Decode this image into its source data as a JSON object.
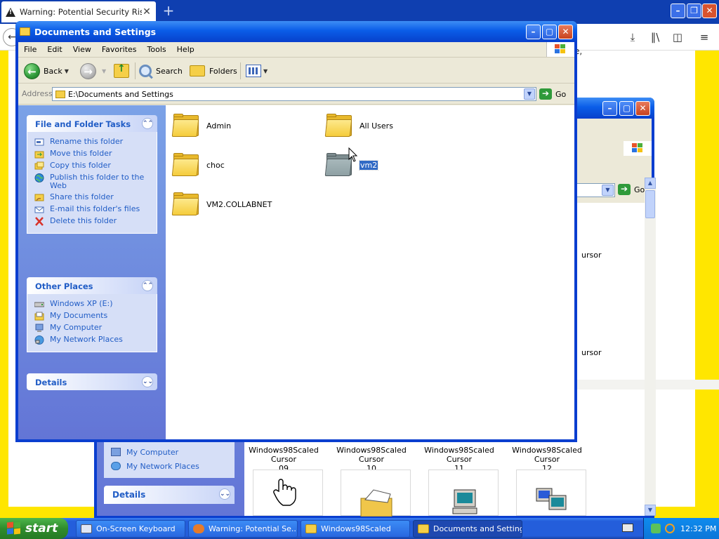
{
  "firefox": {
    "tab_title": "Warning: Potential Security Risk A",
    "side_text": "e,"
  },
  "bg_window": {
    "other_places": [
      "My Computer",
      "My Network Places"
    ],
    "details_label": "Details",
    "go_label": "Go",
    "cursor_labels": [
      {
        "line1": "Windows98Scaled Cursor",
        "line2": "09"
      },
      {
        "line1": "Windows98Scaled Cursor",
        "line2": "10"
      },
      {
        "line1": "Windows98Scaled Cursor",
        "line2": "11"
      },
      {
        "line1": "Windows98Scaled Cursor",
        "line2": "12"
      }
    ],
    "partial_label_1": "ursor",
    "partial_label_2": "ursor"
  },
  "window": {
    "title": "Documents and Settings",
    "menu": [
      "File",
      "Edit",
      "View",
      "Favorites",
      "Tools",
      "Help"
    ],
    "toolbar": {
      "back": "Back",
      "search": "Search",
      "folders": "Folders"
    },
    "address_label": "Address",
    "address_value": "E:\\Documents and Settings",
    "go_label": "Go",
    "panels": {
      "file_tasks": {
        "title": "File and Folder Tasks",
        "items": [
          "Rename this folder",
          "Move this folder",
          "Copy this folder",
          "Publish this folder to the Web",
          "Share this folder",
          "E-mail this folder's files",
          "Delete this folder"
        ]
      },
      "other_places": {
        "title": "Other Places",
        "items": [
          "Windows XP (E:)",
          "My Documents",
          "My Computer",
          "My Network Places"
        ]
      },
      "details": {
        "title": "Details"
      }
    },
    "folders": [
      {
        "name": "Admin",
        "selected": false
      },
      {
        "name": "All Users",
        "selected": false
      },
      {
        "name": "choc",
        "selected": false
      },
      {
        "name": "vm2",
        "selected": true
      },
      {
        "name": "VM2.COLLABNET",
        "selected": false
      }
    ]
  },
  "taskbar": {
    "start_label": "start",
    "buttons": [
      "On-Screen Keyboard",
      "Warning: Potential Se...",
      "Windows98Scaled",
      "Documents and Settings"
    ],
    "clock": "12:32 PM"
  },
  "colors": {
    "xp_blue": "#0a3ecf",
    "task_pane": "#6375d6",
    "link": "#215dc6",
    "firefox_bg": "#ffe600",
    "selection": "#316ac5"
  }
}
